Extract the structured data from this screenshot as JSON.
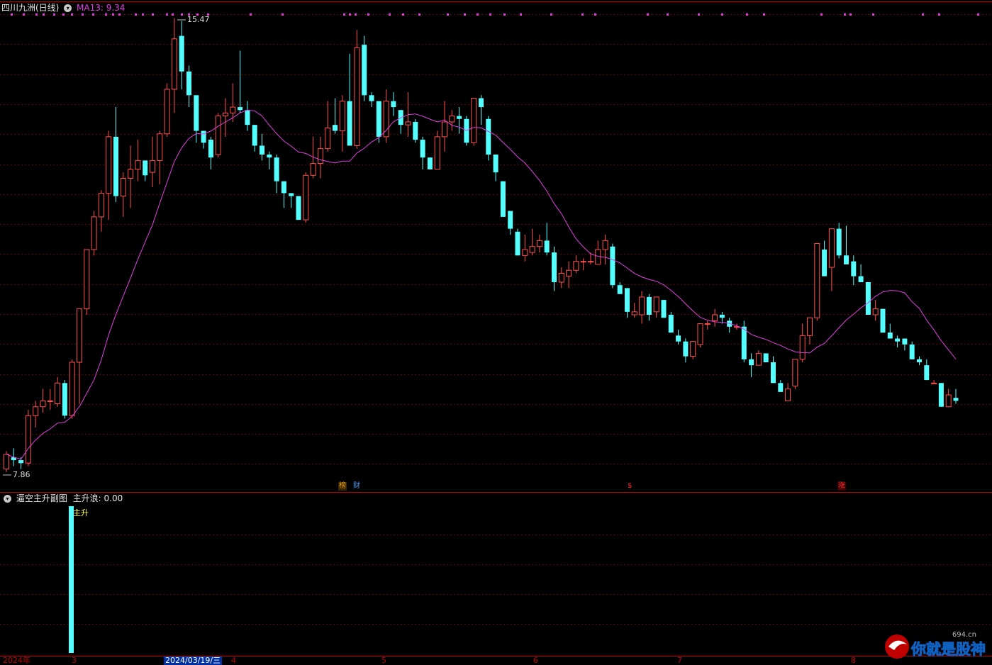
{
  "header": {
    "stock_name": "四川九洲(日线)",
    "ma_label": "MA13: 9.34",
    "ma_color": "#e040e0"
  },
  "main_chart": {
    "high_label": "15.47",
    "low_label": "7.86",
    "markers": [
      {
        "text": "榜",
        "color": "#e0a000"
      },
      {
        "text": "财",
        "color": "#5aa0ff"
      },
      {
        "text": "$",
        "color": "#ff3030"
      },
      {
        "text": "涨",
        "color": "#ff3030"
      }
    ]
  },
  "sub_chart": {
    "title": "逼空主升副图",
    "indicator_label": "主升浪: 0.00",
    "bar_label": "主升"
  },
  "x_axis": {
    "labels": [
      "2024年",
      "3",
      "2024/03/19/三",
      "4",
      "5",
      "6",
      "7",
      "8"
    ]
  },
  "watermark": {
    "domain": "694.cn",
    "text": "你就是股神"
  },
  "colors": {
    "up": "#ff5050",
    "down": "#54ffff",
    "grid": "#6a0000",
    "divider": "#c00000",
    "ma": "#e040e0"
  },
  "chart_data": {
    "type": "candlestick",
    "ma_period": 13,
    "ohlc": [
      [
        7.9,
        8.2,
        7.85,
        8.15
      ],
      [
        8.1,
        8.25,
        7.95,
        8.05
      ],
      [
        8.05,
        8.1,
        7.9,
        8.0
      ],
      [
        8.0,
        8.9,
        7.95,
        8.8
      ],
      [
        8.8,
        9.05,
        8.6,
        8.95
      ],
      [
        8.95,
        9.25,
        8.85,
        9.05
      ],
      [
        9.05,
        9.25,
        8.9,
        9.05
      ],
      [
        9.0,
        9.45,
        8.95,
        9.35
      ],
      [
        9.35,
        9.4,
        8.75,
        8.8
      ],
      [
        8.8,
        9.75,
        8.75,
        9.7
      ],
      [
        9.7,
        10.6,
        9.0,
        10.6
      ],
      [
        10.6,
        11.6,
        10.5,
        11.6
      ],
      [
        11.6,
        12.25,
        11.5,
        12.15
      ],
      [
        12.15,
        12.6,
        11.9,
        12.55
      ],
      [
        12.55,
        13.6,
        12.1,
        13.5
      ],
      [
        13.5,
        14.0,
        12.4,
        12.5
      ],
      [
        12.5,
        12.9,
        12.15,
        12.8
      ],
      [
        12.8,
        13.35,
        12.3,
        12.95
      ],
      [
        12.95,
        13.45,
        12.75,
        13.1
      ],
      [
        13.1,
        13.0,
        12.75,
        12.85
      ],
      [
        12.9,
        13.5,
        12.65,
        13.1
      ],
      [
        13.1,
        13.6,
        12.7,
        13.55
      ],
      [
        13.55,
        14.4,
        13.5,
        14.3
      ],
      [
        14.3,
        15.5,
        13.9,
        15.15
      ],
      [
        15.2,
        15.45,
        14.3,
        14.6
      ],
      [
        14.6,
        14.7,
        14.0,
        14.2
      ],
      [
        14.2,
        14.15,
        13.4,
        13.6
      ],
      [
        13.6,
        13.6,
        13.3,
        13.4
      ],
      [
        13.45,
        13.5,
        12.95,
        13.15
      ],
      [
        13.2,
        13.9,
        13.15,
        13.85
      ],
      [
        13.85,
        14.15,
        13.5,
        13.9
      ],
      [
        13.9,
        14.4,
        13.75,
        14.0
      ],
      [
        14.0,
        14.95,
        13.9,
        13.95
      ],
      [
        13.95,
        14.1,
        13.6,
        13.7
      ],
      [
        13.7,
        13.7,
        13.25,
        13.35
      ],
      [
        13.35,
        13.55,
        13.1,
        13.2
      ],
      [
        13.2,
        13.25,
        12.95,
        13.15
      ],
      [
        13.15,
        13.2,
        12.55,
        12.75
      ],
      [
        12.75,
        12.7,
        12.3,
        12.55
      ],
      [
        12.55,
        12.5,
        12.3,
        12.5
      ],
      [
        12.5,
        12.4,
        12.25,
        12.1
      ],
      [
        12.1,
        12.9,
        12.05,
        12.85
      ],
      [
        12.85,
        13.5,
        12.8,
        13.05
      ],
      [
        13.05,
        13.5,
        12.8,
        13.3
      ],
      [
        13.3,
        14.1,
        13.25,
        13.65
      ],
      [
        13.7,
        14.15,
        13.55,
        13.6
      ],
      [
        13.6,
        14.2,
        13.25,
        14.1
      ],
      [
        14.1,
        14.9,
        13.35,
        13.35
      ],
      [
        13.35,
        15.3,
        13.3,
        15.0
      ],
      [
        15.05,
        15.2,
        14.1,
        14.2
      ],
      [
        14.2,
        14.25,
        14.0,
        14.1
      ],
      [
        14.1,
        14.1,
        13.4,
        13.5
      ],
      [
        13.5,
        14.3,
        13.4,
        14.1
      ],
      [
        14.1,
        14.25,
        13.85,
        14.0
      ],
      [
        13.95,
        13.9,
        13.55,
        13.7
      ],
      [
        13.7,
        14.25,
        13.5,
        13.75
      ],
      [
        13.75,
        13.8,
        13.4,
        13.45
      ],
      [
        13.45,
        13.5,
        12.95,
        13.15
      ],
      [
        13.15,
        13.15,
        13.0,
        12.95
      ],
      [
        12.95,
        13.6,
        12.95,
        13.5
      ],
      [
        13.5,
        14.1,
        13.25,
        13.75
      ],
      [
        13.75,
        13.95,
        13.6,
        13.85
      ],
      [
        13.85,
        14.0,
        13.55,
        13.8
      ],
      [
        13.8,
        13.85,
        13.35,
        13.4
      ],
      [
        13.4,
        14.15,
        13.35,
        14.15
      ],
      [
        14.15,
        14.2,
        13.7,
        14.0
      ],
      [
        13.8,
        13.85,
        13.1,
        13.2
      ],
      [
        13.2,
        13.2,
        12.75,
        12.9
      ],
      [
        12.75,
        12.7,
        12.2,
        12.15
      ],
      [
        12.25,
        12.2,
        11.85,
        11.95
      ],
      [
        11.9,
        11.95,
        11.5,
        11.5
      ],
      [
        11.5,
        11.85,
        11.4,
        11.6
      ],
      [
        11.55,
        11.95,
        11.5,
        11.65
      ],
      [
        11.65,
        11.85,
        11.55,
        11.75
      ],
      [
        11.75,
        12.05,
        11.5,
        11.55
      ],
      [
        11.55,
        11.65,
        10.9,
        11.05
      ],
      [
        11.05,
        11.3,
        10.95,
        11.2
      ],
      [
        11.15,
        11.4,
        10.95,
        11.25
      ],
      [
        11.25,
        11.5,
        11.2,
        11.4
      ],
      [
        11.4,
        11.45,
        11.25,
        11.4
      ],
      [
        11.4,
        11.55,
        11.35,
        11.4
      ],
      [
        11.35,
        11.75,
        11.35,
        11.6
      ],
      [
        11.6,
        11.85,
        11.35,
        11.75
      ],
      [
        11.65,
        11.7,
        10.95,
        11.0
      ],
      [
        11.0,
        11.05,
        10.85,
        10.85
      ],
      [
        10.95,
        10.9,
        10.45,
        10.55
      ],
      [
        10.5,
        10.7,
        10.45,
        10.55
      ],
      [
        10.5,
        10.9,
        10.35,
        10.8
      ],
      [
        10.8,
        10.85,
        10.4,
        10.5
      ],
      [
        10.55,
        10.8,
        10.45,
        10.8
      ],
      [
        10.75,
        10.75,
        10.45,
        10.45
      ],
      [
        10.5,
        10.55,
        10.2,
        10.2
      ],
      [
        10.15,
        10.25,
        10.0,
        10.05
      ],
      [
        10.05,
        10.1,
        9.7,
        9.8
      ],
      [
        9.8,
        10.05,
        9.75,
        10.05
      ],
      [
        10.0,
        10.35,
        9.95,
        10.35
      ],
      [
        10.35,
        10.4,
        10.25,
        10.35
      ],
      [
        10.4,
        10.6,
        10.3,
        10.5
      ],
      [
        10.5,
        10.55,
        10.35,
        10.45
      ],
      [
        10.4,
        10.45,
        10.2,
        10.3
      ],
      [
        10.3,
        10.35,
        10.25,
        10.3
      ],
      [
        10.3,
        10.4,
        9.7,
        9.75
      ],
      [
        9.75,
        9.85,
        9.45,
        9.65
      ],
      [
        9.65,
        9.9,
        9.65,
        9.85
      ],
      [
        9.85,
        9.85,
        9.7,
        9.7
      ],
      [
        9.7,
        9.8,
        9.4,
        9.35
      ],
      [
        9.35,
        9.4,
        9.2,
        9.2
      ],
      [
        9.05,
        9.35,
        9.05,
        9.25
      ],
      [
        9.3,
        9.75,
        9.25,
        9.75
      ],
      [
        9.75,
        10.35,
        9.7,
        10.15
      ],
      [
        10.15,
        10.45,
        10.0,
        10.45
      ],
      [
        10.45,
        11.7,
        10.4,
        11.7
      ],
      [
        11.6,
        11.75,
        11.25,
        11.15
      ],
      [
        11.3,
        11.85,
        10.9,
        11.95
      ],
      [
        11.95,
        12.05,
        11.45,
        11.5
      ],
      [
        11.5,
        12.0,
        11.45,
        11.35
      ],
      [
        11.4,
        11.5,
        11.0,
        11.15
      ],
      [
        11.15,
        11.35,
        11.05,
        11.05
      ],
      [
        11.05,
        11.05,
        10.55,
        10.5
      ],
      [
        10.5,
        10.75,
        10.4,
        10.6
      ],
      [
        10.6,
        10.6,
        10.2,
        10.2
      ],
      [
        10.2,
        10.35,
        10.1,
        10.1
      ],
      [
        10.1,
        10.15,
        9.95,
        10.05
      ],
      [
        10.1,
        10.1,
        9.9,
        10.0
      ],
      [
        10.0,
        10.05,
        9.75,
        9.75
      ],
      [
        9.75,
        9.8,
        9.65,
        9.7
      ],
      [
        9.65,
        9.75,
        9.4,
        9.4
      ],
      [
        9.35,
        9.4,
        9.35,
        9.35
      ],
      [
        9.35,
        9.3,
        9.0,
        8.95
      ],
      [
        8.95,
        9.25,
        8.95,
        9.15
      ],
      [
        9.1,
        9.25,
        9.0,
        9.05
      ]
    ],
    "ma13_note": "computed from ohlc closes",
    "sub_values": [
      {
        "index": 10,
        "value": 1
      }
    ],
    "ylim": [
      7.5,
      16.2
    ]
  }
}
